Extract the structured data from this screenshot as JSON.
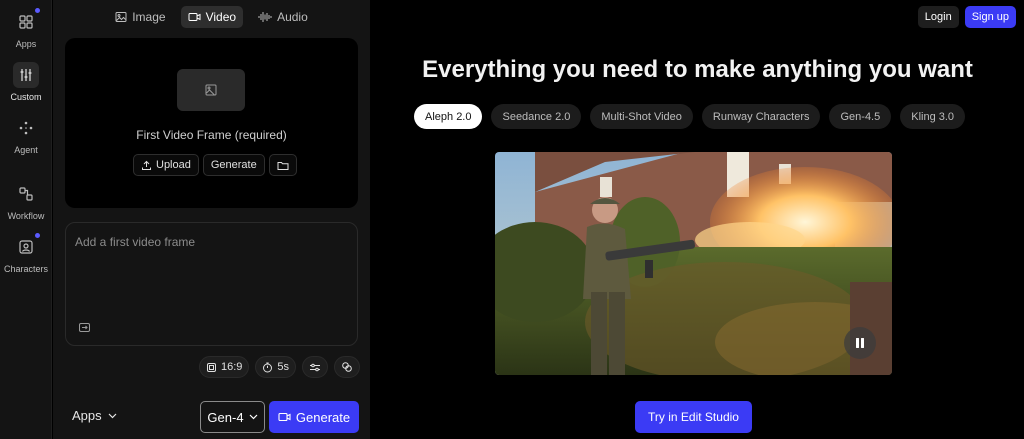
{
  "rail": {
    "items": [
      {
        "label": "Apps",
        "icon": "grid-icon"
      },
      {
        "label": "Custom",
        "icon": "sliders-icon"
      },
      {
        "label": "Agent",
        "icon": "sparkle-dots-icon"
      },
      {
        "label": "Workflow",
        "icon": "workflow-icon"
      },
      {
        "label": "Characters",
        "icon": "character-icon"
      }
    ]
  },
  "modes": [
    {
      "label": "Image",
      "icon": "image-icon"
    },
    {
      "label": "Video",
      "icon": "video-icon"
    },
    {
      "label": "Audio",
      "icon": "waveform-icon"
    }
  ],
  "frame": {
    "title": "First Video Frame (required)",
    "upload_label": "Upload",
    "generate_label": "Generate"
  },
  "prompt": {
    "placeholder": "Add a first video frame"
  },
  "settings": {
    "aspect": "16:9",
    "duration": "5s"
  },
  "bottom": {
    "apps_label": "Apps",
    "model": "Gen-4",
    "generate_label": "Generate"
  },
  "header": {
    "login": "Login",
    "signup": "Sign up"
  },
  "main": {
    "headline": "Everything you need to make anything you want",
    "models": [
      "Aleph 2.0",
      "Seedance 2.0",
      "Multi-Shot Video",
      "Runway Characters",
      "Gen-4.5",
      "Kling 3.0"
    ],
    "cta": "Try in Edit Studio"
  },
  "colors": {
    "accent": "#3b3bf5",
    "background": "#000000",
    "panel": "#141414"
  }
}
